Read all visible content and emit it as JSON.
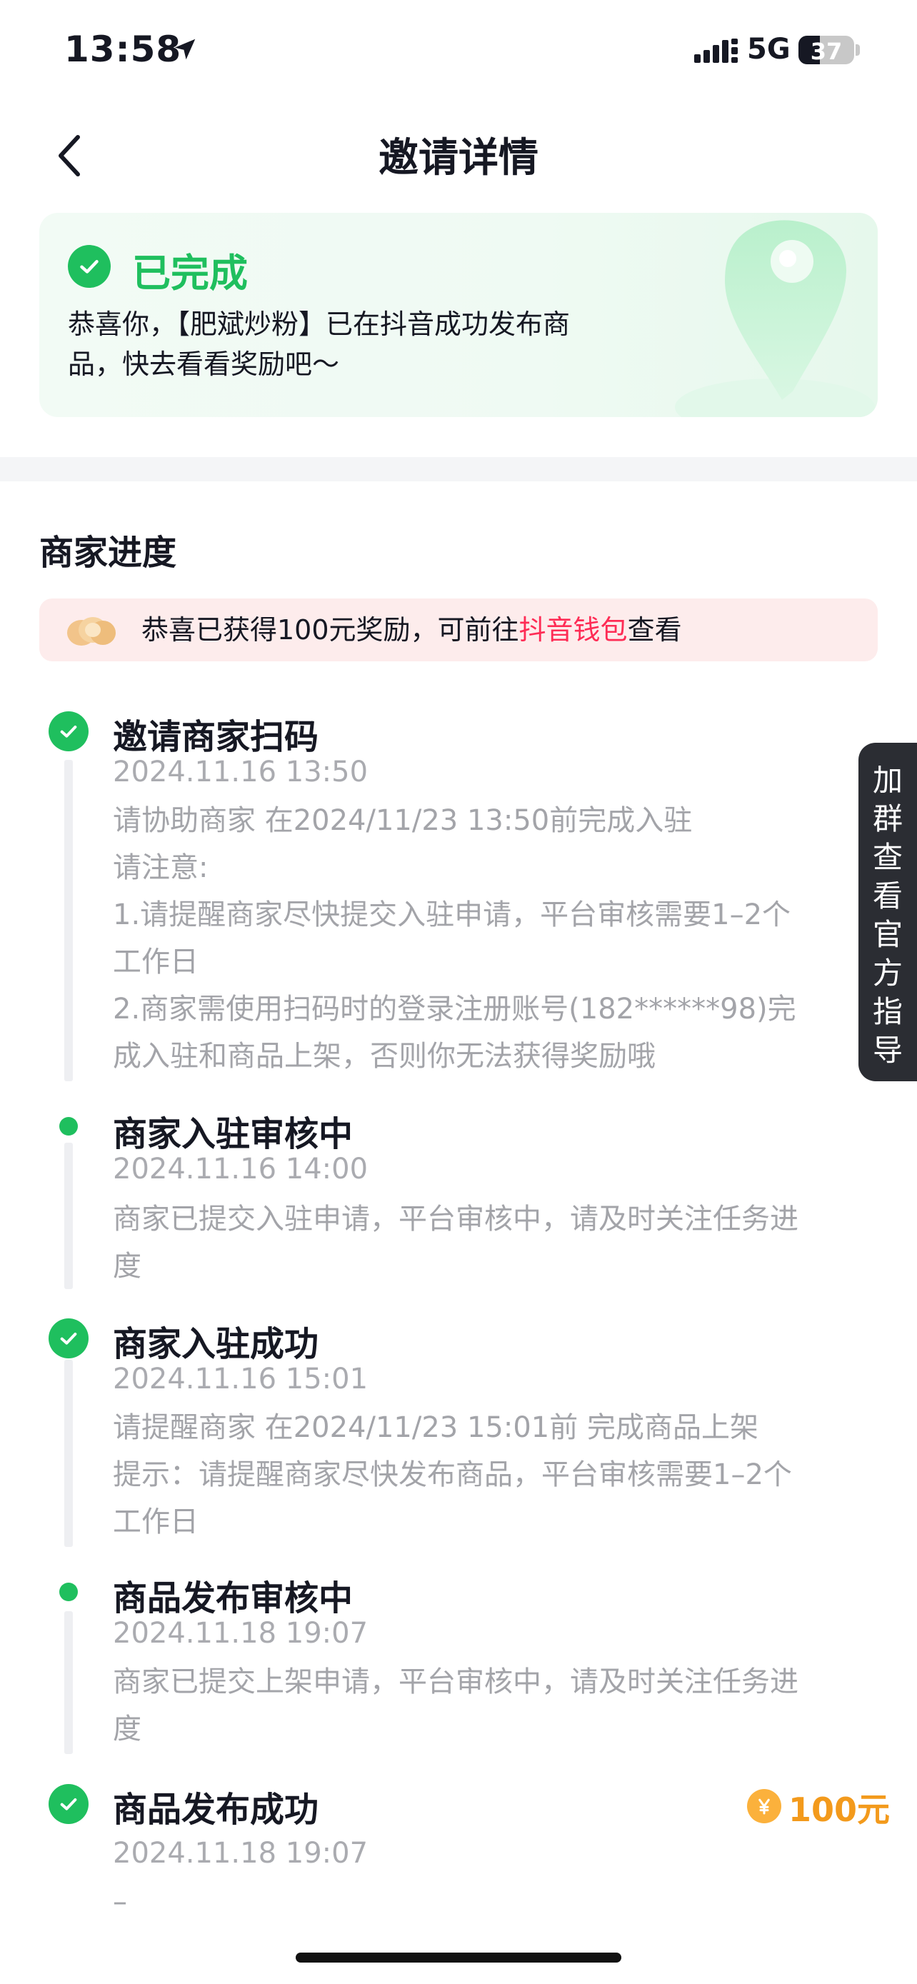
{
  "status_bar": {
    "time": "13:58",
    "network": "5G",
    "battery": "37"
  },
  "nav": {
    "title": "邀请详情"
  },
  "completion": {
    "status": "已完成",
    "desc_line1": "恭喜你，【肥斌炒粉】已在抖音成功发布商",
    "desc_line2": "品，快去看看奖励吧～"
  },
  "section": {
    "title": "商家进度"
  },
  "reward_banner": {
    "prefix": "恭喜已获得100元奖励，可前往",
    "link": "抖音钱包",
    "suffix": "查看"
  },
  "side_tab": {
    "label": "加群查看官方指导"
  },
  "steps": [
    {
      "title": "邀请商家扫码",
      "time": "2024.11.16 13:50",
      "lines": [
        "请协助商家 在2024/11/23 13:50前完成入驻",
        "请注意:",
        "1.请提醒商家尽快提交入驻申请，平台审核需要1–2个",
        "工作日",
        "2.商家需使用扫码时的登录注册账号(182******98)完",
        "成入驻和商品上架，否则你无法获得奖励哦"
      ]
    },
    {
      "title": "商家入驻审核中",
      "time": "2024.11.16 14:00",
      "lines": [
        "商家已提交入驻申请，平台审核中，请及时关注任务进",
        "度"
      ]
    },
    {
      "title": "商家入驻成功",
      "time": "2024.11.16 15:01",
      "lines": [
        "请提醒商家 在2024/11/23 15:01前 完成商品上架",
        "提示：请提醒商家尽快发布商品，平台审核需要1–2个",
        "工作日"
      ]
    },
    {
      "title": "商品发布审核中",
      "time": "2024.11.18 19:07",
      "lines": [
        "商家已提交上架申请，平台审核中，请及时关注任务进",
        "度"
      ]
    },
    {
      "title": "商品发布成功",
      "time": "2024.11.18 19:07",
      "lines": [
        "–"
      ],
      "reward": "100元",
      "reward_icon": "yen-coin-icon"
    }
  ],
  "colors": {
    "accent_green": "#1fbf5e",
    "link_red": "#fe2c55",
    "reward_orange": "#f39a1c"
  }
}
